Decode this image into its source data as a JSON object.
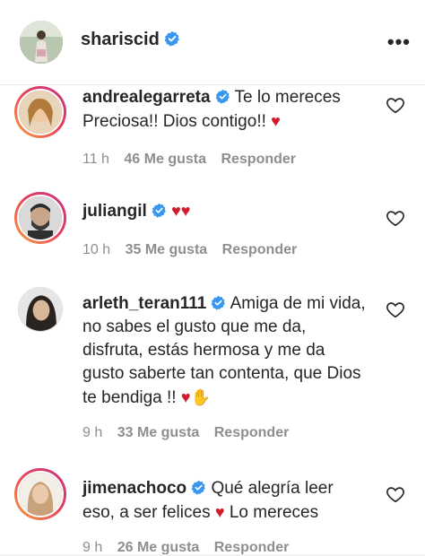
{
  "header": {
    "username": "shariscid",
    "more_label": "•••"
  },
  "comments": [
    {
      "username": "andrealegarreta",
      "text": "Te lo mereces Preciosa!! Dios contigo!!",
      "emojis": "♥",
      "time": "11 h",
      "likes": "46 Me gusta",
      "reply": "Responder"
    },
    {
      "username": "juliangil",
      "text": "",
      "emojis": "♥♥",
      "time": "10 h",
      "likes": "35 Me gusta",
      "reply": "Responder"
    },
    {
      "username": "arleth_teran111",
      "text": "Amiga de mi vida, no sabes el gusto que me da, disfruta, estás hermosa y me da gusto saberte tan contenta, que Dios te bendiga !!",
      "emojis": "♥✋",
      "time": "9 h",
      "likes": "33 Me gusta",
      "reply": "Responder"
    },
    {
      "username": "jimenachoco",
      "text": "Qué alegría leer eso, a ser felices",
      "emojis": "♥",
      "text_after": "Lo mereces",
      "time": "9 h",
      "likes": "26 Me gusta",
      "reply": "Responder"
    }
  ],
  "colors": {
    "verified": "#3897f0",
    "heart_emoji": "#d11a2a",
    "meta": "#8e8e8e"
  }
}
